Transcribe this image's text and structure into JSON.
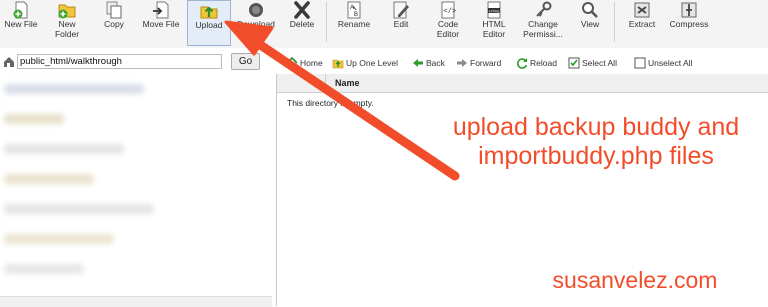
{
  "toolbar": {
    "buttons": [
      {
        "id": "new-file",
        "label": "New File",
        "icon": "new-file-icon"
      },
      {
        "id": "new-folder",
        "label": "New\nFolder",
        "icon": "new-folder-icon"
      },
      {
        "id": "copy",
        "label": "Copy",
        "icon": "copy-icon"
      },
      {
        "id": "move-file",
        "label": "Move File",
        "icon": "move-file-icon"
      },
      {
        "id": "upload",
        "label": "Upload",
        "icon": "upload-icon"
      },
      {
        "id": "download",
        "label": "Download",
        "icon": "download-icon"
      },
      {
        "id": "delete",
        "label": "Delete",
        "icon": "delete-icon"
      },
      {
        "id": "rename",
        "label": "Rename",
        "icon": "rename-icon"
      },
      {
        "id": "edit",
        "label": "Edit",
        "icon": "edit-icon"
      },
      {
        "id": "code-editor",
        "label": "Code\nEditor",
        "icon": "code-editor-icon"
      },
      {
        "id": "html-editor",
        "label": "HTML\nEditor",
        "icon": "html-editor-icon"
      },
      {
        "id": "change-permissions",
        "label": "Change\nPermissi...",
        "icon": "key-icon"
      },
      {
        "id": "view",
        "label": "View",
        "icon": "magnifier-icon"
      },
      {
        "id": "extract",
        "label": "Extract",
        "icon": "extract-icon"
      },
      {
        "id": "compress",
        "label": "Compress",
        "icon": "compress-icon"
      }
    ]
  },
  "path_bar": {
    "value": "public_html/walkthrough",
    "go_label": "Go"
  },
  "nav": {
    "home": "Home",
    "up_one_level": "Up One Level",
    "back": "Back",
    "forward": "Forward",
    "reload": "Reload",
    "select_all": "Select All",
    "unselect_all": "Unselect All"
  },
  "file_list": {
    "column_name": "Name",
    "empty_message": "This directory is empty."
  },
  "annotation": {
    "line1": "upload backup buddy and",
    "line2": "importbuddy.php files",
    "color": "#f24d2a"
  },
  "watermark": "susanvelez.com",
  "colors": {
    "toolbar_bg": "#f4f4f4",
    "arrow": "#f24d2a",
    "upload_highlight": "#e4ecf7"
  }
}
